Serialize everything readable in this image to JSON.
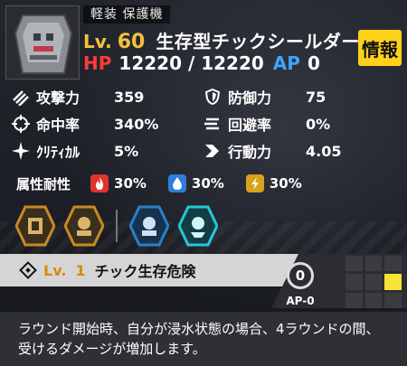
{
  "header": {
    "class_tag": "軽装 保護機",
    "lv_label": "Lv.",
    "level": "60",
    "unit_name": "生存型チックシールダー",
    "hp_label": "HP",
    "hp_value": "12220 / 12220",
    "ap_label": "AP",
    "ap_value": "0",
    "info_button": "情報"
  },
  "stats": {
    "attack": {
      "label": "攻撃力",
      "value": "359"
    },
    "defense": {
      "label": "防御力",
      "value": "75"
    },
    "accuracy": {
      "label": "命中率",
      "value": "340%"
    },
    "evasion": {
      "label": "回避率",
      "value": "0%"
    },
    "critical": {
      "label": "ｸﾘﾃｨｶﾙ",
      "value": "5%"
    },
    "speed": {
      "label": "行動力",
      "value": "4.05"
    }
  },
  "resistances": {
    "title": "属性耐性",
    "fire": {
      "value": "30%",
      "color": "#e0332c"
    },
    "ice": {
      "value": "30%",
      "color": "#2f7ed8"
    },
    "electric": {
      "value": "30%",
      "color": "#d9a21b"
    }
  },
  "skill_icons": [
    {
      "name": "skill-1-icon",
      "color": "#c98a22"
    },
    {
      "name": "skill-2-icon",
      "color": "#c98a22"
    },
    {
      "name": "skill-3-icon",
      "color": "#2a80c9"
    },
    {
      "name": "skill-4-icon",
      "color": "#27c7d6"
    }
  ],
  "selected_skill": {
    "lv_label": "Lv.",
    "level": "1",
    "name": "チック生存危険",
    "ap_cost": "0",
    "ap_text": "AP-0",
    "grid": [
      0,
      0,
      0,
      0,
      0,
      1,
      0,
      0,
      0
    ]
  },
  "description": "ラウンド開始時、自分が浸水状態の場合、4ラウンドの間、受けるダメージが増加します。"
}
